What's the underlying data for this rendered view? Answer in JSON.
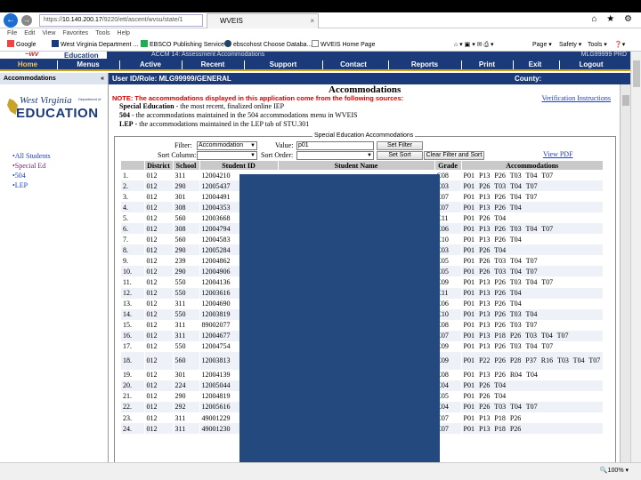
{
  "browser": {
    "url_host": "https://",
    "url_ip": "10.140.200.17",
    "url_path": "/9220/ett/ascent/wvsu/state/1",
    "tab_title": "WVEIS",
    "tab_close": "×",
    "window_icons": "⌂ ★ ⚙",
    "menus": [
      "File",
      "Edit",
      "View",
      "Favorites",
      "Tools",
      "Help"
    ],
    "favorites": [
      "Google",
      "West Virginia Department ...",
      "EBSCO Publishing Service ...",
      "ebscohost Choose Databa...",
      "WVEIS Home Page"
    ],
    "commands": [
      "Page ▾",
      "Safety ▾",
      "Tools ▾"
    ],
    "zoom": "🔍100% ▾"
  },
  "header": {
    "logo_fragment": "Education",
    "top_band_text": "ACCM 14: Assessment Accommodations",
    "top_band_right": "MLG99999 PRD",
    "nav": [
      "Home",
      "Menus",
      "Active",
      "Recent",
      "Support",
      "Contact",
      "Reports",
      "Print",
      "Exit",
      "Logout"
    ],
    "accommodations_caption": "Accommodations",
    "collapse_glyph": "«",
    "user_role": "User ID/Role:     MLG99999/GENERAL",
    "county_label": "County:"
  },
  "left": {
    "logo_wv": "West Virginia",
    "logo_dept": "Department of",
    "logo_ed": "EDUCATION",
    "links": [
      "•All Students",
      "•Special Ed",
      "•504",
      "•LEP"
    ]
  },
  "main": {
    "title": "Accommodations",
    "note": "NOTE: The accommodations displayed in this application come from the following sources:",
    "sources": [
      {
        "term": "Special Education",
        "desc": " - the most recent, finalized online IEP"
      },
      {
        "term": "504",
        "desc": " - the accommodations maintained in the 504 accommodations menu in WVEIS"
      },
      {
        "term": "LEP",
        "desc": " - the accommodations maintained in the LEP tab of STU.301"
      }
    ],
    "verification_link": "Verification Instructions",
    "fieldset_legend": "Special Education Accommodations",
    "filter_label": "Filter:",
    "filter_value": "Accommodation",
    "value_label": "Value:",
    "value_input": "p01",
    "set_filter": "Set Filter",
    "sort_column_label": "Sort Column:",
    "sort_order_label": "Sort Order:",
    "set_sort": "Set Sort",
    "clear_filter": "Clear Filter and Sort",
    "view_pdf": "View PDF",
    "columns": [
      "",
      "District",
      "School",
      "Student ID",
      "Student Name",
      "Grade",
      "Accommodations"
    ],
    "rows": [
      [
        "1.",
        "012",
        "311",
        "12004210",
        "C08",
        "P01 P13 P26 T03 T04 T07"
      ],
      [
        "2.",
        "012",
        "290",
        "12005437",
        "C03",
        "P01 P26 T03 T04 T07"
      ],
      [
        "3.",
        "012",
        "301",
        "12004491",
        "C07",
        "P01 P13 P26 T04 T07"
      ],
      [
        "4.",
        "012",
        "308",
        "12004353",
        "C07",
        "P01 P13 P26 T04"
      ],
      [
        "5.",
        "012",
        "560",
        "12003668",
        "C11",
        "P01 P26 T04"
      ],
      [
        "6.",
        "012",
        "308",
        "12004794",
        "C06",
        "P01 P13 P26 T03 T04 T07"
      ],
      [
        "7.",
        "012",
        "560",
        "12004583",
        "C10",
        "P01 P13 P26 T04"
      ],
      [
        "8.",
        "012",
        "290",
        "12005284",
        "C03",
        "P01 P26 T04"
      ],
      [
        "9.",
        "012",
        "239",
        "12004862",
        "C05",
        "P01 P26 T03 T04 T07"
      ],
      [
        "10.",
        "012",
        "290",
        "12004906",
        "C05",
        "P01 P26 T03 T04 T07"
      ],
      [
        "11.",
        "012",
        "550",
        "12004136",
        "C09",
        "P01 P13 P26 T03 T04 T07"
      ],
      [
        "12.",
        "012",
        "550",
        "12003616",
        "C11",
        "P01 P13 P26 T04"
      ],
      [
        "13.",
        "012",
        "311",
        "12004690",
        "C06",
        "P01 P13 P26 T04"
      ],
      [
        "14.",
        "012",
        "550",
        "12003819",
        "C10",
        "P01 P13 P26 T03 T04"
      ],
      [
        "15.",
        "012",
        "311",
        "89002077",
        "C08",
        "P01 P13 P26 T03 T07"
      ],
      [
        "16.",
        "012",
        "311",
        "12004677",
        "C07",
        "P01 P13 P18 P26 T03 T04 T07"
      ],
      [
        "17.",
        "012",
        "550",
        "12004754",
        "C09",
        "P01 P13 P26 T03 T04 T07"
      ],
      [
        "18.",
        "012",
        "560",
        "12003813",
        "C09",
        "P01 P22 P26 P28 P37 R16 T03 T04 T07"
      ],
      [
        "19.",
        "012",
        "301",
        "12004139",
        "C08",
        "P01 P13 P26 R04 T04"
      ],
      [
        "20.",
        "012",
        "224",
        "12005044",
        "C04",
        "P01 P26 T04"
      ],
      [
        "21.",
        "012",
        "290",
        "12004819",
        "C05",
        "P01 P26 T04"
      ],
      [
        "22.",
        "012",
        "292",
        "12005616",
        "C04",
        "P01 P26 T03 T04 T07"
      ],
      [
        "23.",
        "012",
        "311",
        "49001229",
        "C07",
        "P01 P13 P18 P26"
      ],
      [
        "24.",
        "012",
        "311",
        "49001230",
        "C07",
        "P01 P13 P18 P26"
      ]
    ]
  },
  "colors": {
    "nav_blue": "#1b3a7a",
    "nav_active": "#f3c54a",
    "gold": "#c9a227",
    "link": "#1a3ec8",
    "note_red": "#dd0000",
    "redaction": "#23497f"
  }
}
